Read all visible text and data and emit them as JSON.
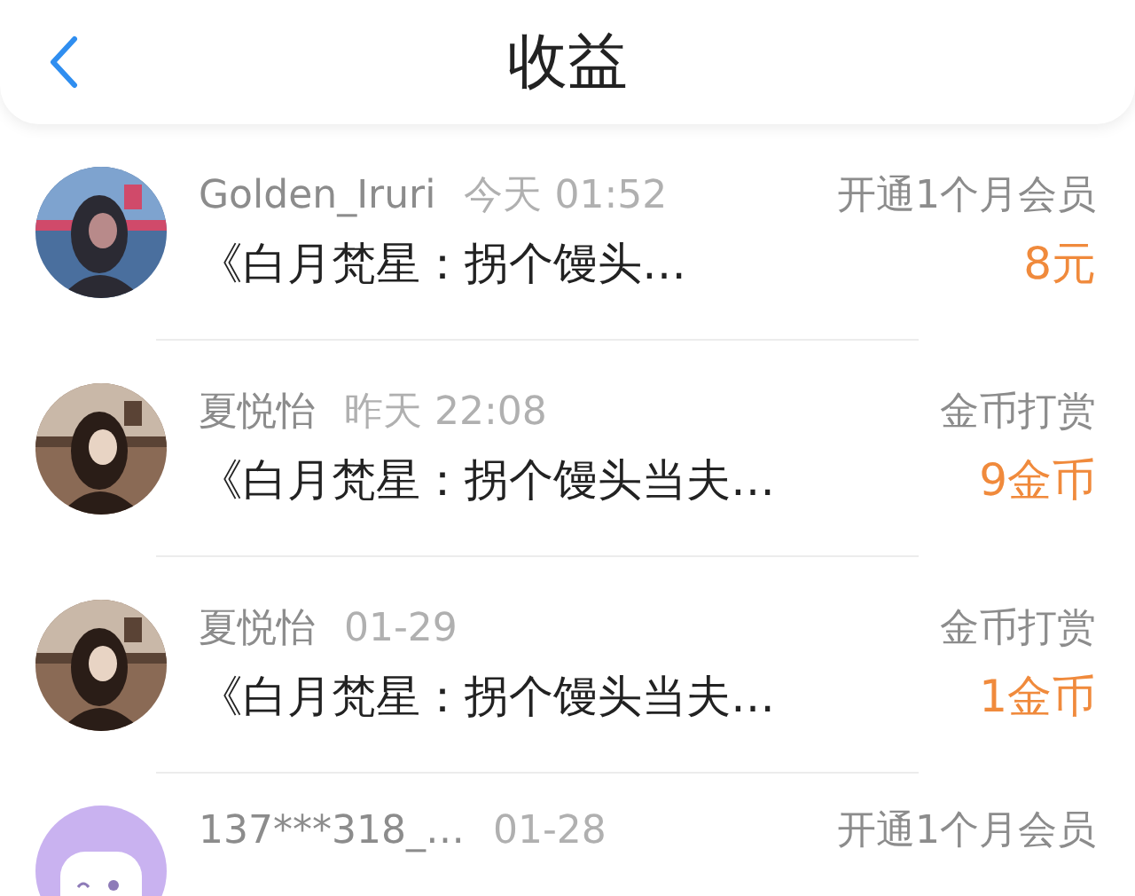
{
  "header": {
    "title": "收益"
  },
  "rows": [
    {
      "name": "Golden_Iruri",
      "time": "今天 01:52",
      "type": "开通1个月会员",
      "book": "《白月梵星：拐个馒头…",
      "amount": "8元"
    },
    {
      "name": "夏悦怡",
      "time": "昨天 22:08",
      "type": "金币打赏",
      "book": "《白月梵星：拐个馒头当夫…",
      "amount": "9金币"
    },
    {
      "name": "夏悦怡",
      "time": "01-29",
      "type": "金币打赏",
      "book": "《白月梵星：拐个馒头当夫…",
      "amount": "1金币"
    },
    {
      "avatar": {
        "kind": "cartoon"
      },
      "name": "137***318_…",
      "time": "01-28",
      "type": "开通1个月会员"
    }
  ]
}
